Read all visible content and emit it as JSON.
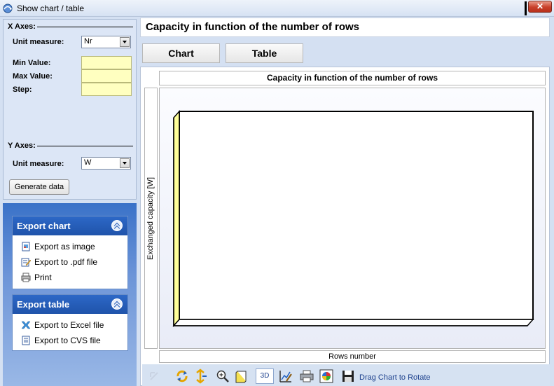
{
  "window": {
    "title": "Show chart / table",
    "close_label": "✕"
  },
  "x_axes": {
    "heading": "X Axes:",
    "unit_label": "Unit measure:",
    "unit_value": "Nr",
    "min_label": "Min Value:",
    "max_label": "Max Value:",
    "step_label": "Step:",
    "min_value": "",
    "max_value": "",
    "step_value": ""
  },
  "y_axes": {
    "heading": "Y Axes:",
    "unit_label": "Unit measure:",
    "unit_value": "W"
  },
  "generate_button": "Generate data",
  "export_chart": {
    "title": "Export chart",
    "items": [
      "Export as image",
      "Export to .pdf file",
      "Print"
    ]
  },
  "export_table": {
    "title": "Export table",
    "items": [
      "Export to Excel file",
      "Export to CVS file"
    ]
  },
  "main": {
    "title": "Capacity in function of the number of rows",
    "tabs": [
      "Chart",
      "Table"
    ]
  },
  "chart_data": {
    "type": "bar",
    "title": "Capacity in function of the number of rows",
    "xlabel": "Rows number",
    "ylabel": "Exchanged capacity [W]",
    "categories": [],
    "values": [],
    "grid": false,
    "view3d": true
  },
  "toolbar": {
    "btn_3d": "3D",
    "hint": "Drag Chart to Rotate"
  },
  "colors": {
    "accent": "#1f53aa",
    "input_yellow": "#ffffc0",
    "wall_yellow": "#ffff99"
  }
}
